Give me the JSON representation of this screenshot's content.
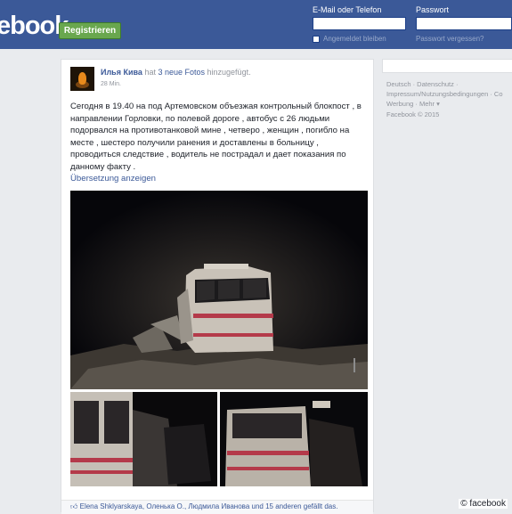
{
  "header": {
    "logo": "ebook",
    "register_label": "Registrieren",
    "email_label": "E-Mail oder Telefon",
    "password_label": "Passwort",
    "remember_label": "Angemeldet bleiben",
    "forgot_label": "Passwort vergessen?"
  },
  "post": {
    "author": "Илья Кива",
    "action": "hat",
    "photos_link": "3 neue Fotos",
    "action_suffix": "hinzugefügt.",
    "time": "28 Min.",
    "text": "Сегодня в 19.40 на под Артемовском объезжая контрольный блокпост , в направлении Горловки, по полевой дороге , автобус с 26 людьми подорвался на противотанковой мине , четверо , женщин , погибло на месте , шестеро получили ранения и доставлены в больницу , проводиться следствие , водитель не пострадал и дает показания по данному факту .",
    "translate_label": "Übersetzung anzeigen",
    "likes_text": "Elena Shklyarskaya, Оленька О., Людмила Иванова und 15 anderen gefällt das."
  },
  "footer": {
    "line1": "Deutsch · Datenschutz ·",
    "line2": "Impressum/Nutzungsbedingungen · Co",
    "line3": "Werbung · Mehr ▾",
    "line4": "Facebook © 2015"
  },
  "credit": "© facebook",
  "colors": {
    "brand": "#3b5998",
    "register": "#69a74e",
    "background": "#e9ebee"
  }
}
